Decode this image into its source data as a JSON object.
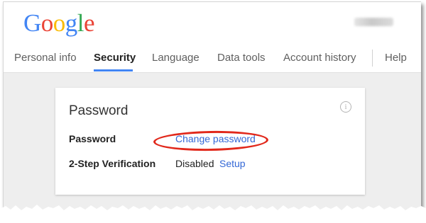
{
  "header": {
    "logo_letters": [
      "G",
      "o",
      "o",
      "g",
      "l",
      "e"
    ],
    "account_name": ""
  },
  "nav": {
    "items": [
      {
        "label": "Personal info"
      },
      {
        "label": "Security"
      },
      {
        "label": "Language"
      },
      {
        "label": "Data tools"
      },
      {
        "label": "Account history"
      },
      {
        "label": "Help"
      }
    ],
    "active": "Security"
  },
  "card": {
    "title": "Password",
    "info_icon": "i",
    "rows": [
      {
        "label": "Password",
        "value": "",
        "link": "Change password"
      },
      {
        "label": "2-Step Verification",
        "value": "Disabled",
        "link": "Setup"
      }
    ]
  },
  "colors": {
    "accent": "#4285f4",
    "link": "#3367d6",
    "highlight": "#e1281b"
  },
  "icons": {
    "info": "info-circle-icon"
  }
}
